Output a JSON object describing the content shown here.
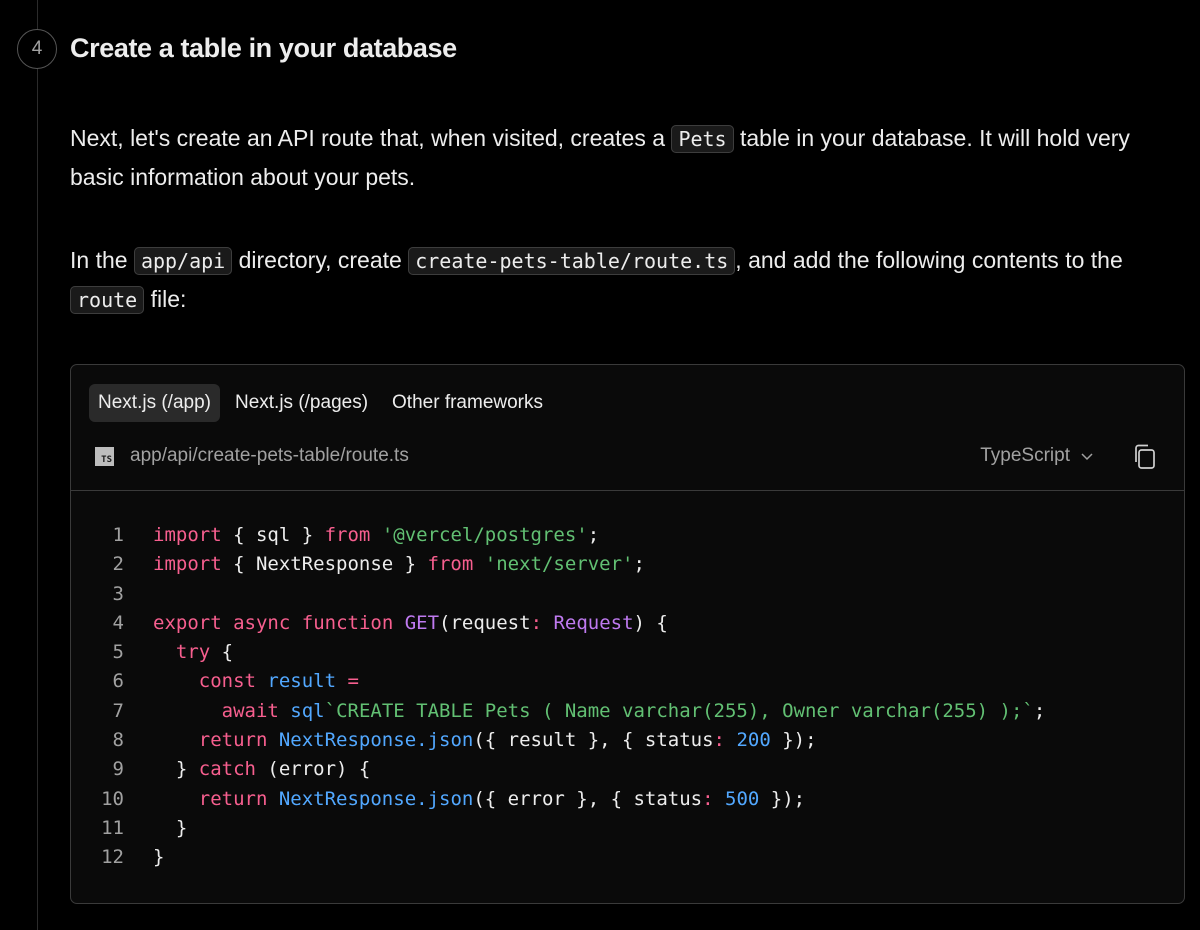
{
  "step": {
    "number": "4",
    "title": "Create a table in your database"
  },
  "paragraph1": {
    "part1": "Next, let's create an API route that, when visited, creates a ",
    "code1": "Pets",
    "part2": " table in your database. It will hold very basic information about your pets."
  },
  "paragraph2": {
    "part1": "In the ",
    "code1": "app/api",
    "part2": " directory, create ",
    "code2": "create-pets-table/route.ts",
    "part3": ", and add the following contents to the ",
    "code3": "route",
    "part4": " file:"
  },
  "code_block": {
    "tabs": [
      "Next.js (/app)",
      "Next.js (/pages)",
      "Other frameworks"
    ],
    "active_tab": "Next.js (/app)",
    "file_icon_text": "TS",
    "file_path": "app/api/create-pets-table/route.ts",
    "language": "TypeScript",
    "icons": {
      "language_dropdown": "chevron-down-icon",
      "copy": "copy-icon",
      "file": "typescript-file-icon"
    },
    "lines": [
      {
        "n": "1",
        "tokens": [
          [
            "kw",
            "import"
          ],
          [
            "p",
            " { sql } "
          ],
          [
            "kw",
            "from"
          ],
          [
            "p",
            " "
          ],
          [
            "str",
            "'@vercel/postgres'"
          ],
          [
            "p",
            ";"
          ]
        ]
      },
      {
        "n": "2",
        "tokens": [
          [
            "kw",
            "import"
          ],
          [
            "p",
            " { NextResponse } "
          ],
          [
            "kw",
            "from"
          ],
          [
            "p",
            " "
          ],
          [
            "str",
            "'next/server'"
          ],
          [
            "p",
            ";"
          ]
        ]
      },
      {
        "n": "3",
        "tokens": []
      },
      {
        "n": "4",
        "tokens": [
          [
            "kw",
            "export"
          ],
          [
            "p",
            " "
          ],
          [
            "kw",
            "async"
          ],
          [
            "p",
            " "
          ],
          [
            "kw",
            "function"
          ],
          [
            "p",
            " "
          ],
          [
            "ty",
            "GET"
          ],
          [
            "p",
            "(request"
          ],
          [
            "kw",
            ":"
          ],
          [
            "p",
            " "
          ],
          [
            "ty",
            "Request"
          ],
          [
            "p",
            ") {"
          ]
        ]
      },
      {
        "n": "5",
        "tokens": [
          [
            "p",
            "  "
          ],
          [
            "kw",
            "try"
          ],
          [
            "p",
            " {"
          ]
        ]
      },
      {
        "n": "6",
        "tokens": [
          [
            "p",
            "    "
          ],
          [
            "kw",
            "const"
          ],
          [
            "p",
            " "
          ],
          [
            "fn",
            "result"
          ],
          [
            "p",
            " "
          ],
          [
            "kw",
            "="
          ]
        ]
      },
      {
        "n": "7",
        "tokens": [
          [
            "p",
            "      "
          ],
          [
            "kw",
            "await"
          ],
          [
            "p",
            " "
          ],
          [
            "fn",
            "sql"
          ],
          [
            "str",
            "`CREATE TABLE Pets ( Name varchar(255), Owner varchar(255) );`"
          ],
          [
            "p",
            ";"
          ]
        ]
      },
      {
        "n": "8",
        "tokens": [
          [
            "p",
            "    "
          ],
          [
            "kw",
            "return"
          ],
          [
            "p",
            " "
          ],
          [
            "fn",
            "NextResponse.json"
          ],
          [
            "p",
            "({ result }, { status"
          ],
          [
            "kw",
            ":"
          ],
          [
            "p",
            " "
          ],
          [
            "num",
            "200"
          ],
          [
            "p",
            " });"
          ]
        ]
      },
      {
        "n": "9",
        "tokens": [
          [
            "p",
            "  } "
          ],
          [
            "kw",
            "catch"
          ],
          [
            "p",
            " (error) {"
          ]
        ]
      },
      {
        "n": "10",
        "tokens": [
          [
            "p",
            "    "
          ],
          [
            "kw",
            "return"
          ],
          [
            "p",
            " "
          ],
          [
            "fn",
            "NextResponse.json"
          ],
          [
            "p",
            "({ error }, { status"
          ],
          [
            "kw",
            ":"
          ],
          [
            "p",
            " "
          ],
          [
            "num",
            "500"
          ],
          [
            "p",
            " });"
          ]
        ]
      },
      {
        "n": "11",
        "tokens": [
          [
            "p",
            "  }"
          ]
        ]
      },
      {
        "n": "12",
        "tokens": [
          [
            "p",
            "}"
          ]
        ]
      }
    ]
  },
  "colors": {
    "background": "#000000",
    "keyword": "#f75f8f",
    "string": "#62c073",
    "function": "#52a8ff",
    "type": "#bf7af0",
    "text": "#ededed",
    "muted": "#a1a1a1"
  }
}
